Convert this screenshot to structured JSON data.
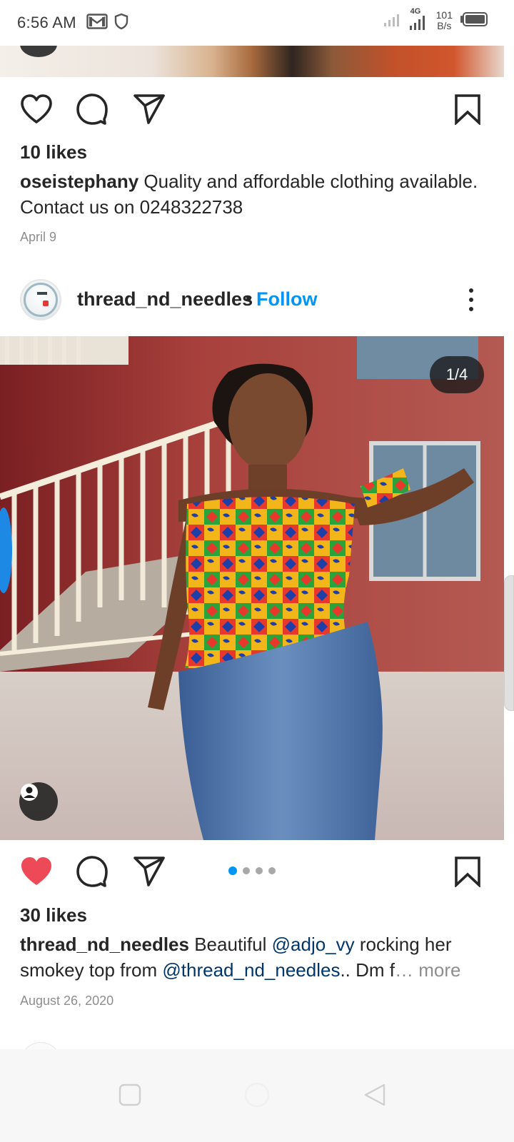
{
  "status_bar": {
    "time": "6:56 AM",
    "network_type": "4G",
    "speed_value": "101",
    "speed_unit": "B/s",
    "icons": [
      "gmail-icon",
      "shield-icon",
      "signal-icon",
      "signal-4g-icon",
      "battery-icon"
    ]
  },
  "previous_post": {
    "likes": "10 likes",
    "username": "oseistephany",
    "caption": "Quality and affordable clothing available. Contact us on 0248322738",
    "date": "April 9",
    "liked": false
  },
  "post": {
    "username": "thread_nd_needles",
    "separator": "•",
    "follow_label": "Follow",
    "image_counter": "1/4",
    "image_index": 1,
    "image_count": 4,
    "likes": "30 likes",
    "liked": true,
    "caption": {
      "username": "thread_nd_needles",
      "text_1": "Beautiful ",
      "mention_1": "@adjo_vy",
      "text_2": " rocking her smokey top from ",
      "mention_2": "@thread_nd_needles",
      "text_3": ".. Dm f",
      "ellipsis": "…",
      "more_label": " more"
    },
    "date": "August 26, 2020"
  },
  "colors": {
    "accent_blue": "#0095f6",
    "like_red": "#ed4956",
    "mention_blue": "#00376b",
    "text_primary": "#262626",
    "text_secondary": "#8e8e8e"
  },
  "nav_bar": {
    "icons": [
      "recent-apps-icon",
      "home-icon",
      "back-icon"
    ]
  }
}
